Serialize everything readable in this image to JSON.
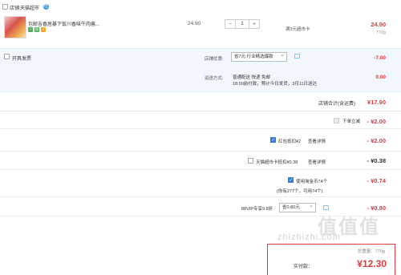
{
  "shop": {
    "label": "店铺:",
    "name": "天猫超市",
    "ww_icon": "旺"
  },
  "item": {
    "title": "包邮吉香居暴下饭川香味牛肉酱...",
    "tags": [
      {
        "text": "7",
        "color": "#4caf50"
      },
      {
        "text": "保",
        "color": "#4caf50"
      },
      {
        "text": "✦",
        "color": "#f5a623"
      }
    ],
    "unit_price": "24.90",
    "quantity": "1",
    "minus": "−",
    "plus": "+",
    "limit_text": "满3元超市卡",
    "total": "24.90",
    "weight": "770g"
  },
  "invoice": {
    "label": "开具发票"
  },
  "discount": {
    "label": "店铺优惠:",
    "selected": "省7元:行业精选爆款",
    "amount": "-7.00"
  },
  "shipping": {
    "label": "运送方式:",
    "methods": "普通配送 快递 免邮",
    "eta": "18:00前付款，预计今日发货，3月11日送达",
    "fee": "0.00"
  },
  "shop_total": {
    "label": "店铺合计(含运费)",
    "value": "¥17.90"
  },
  "order_rows": [
    {
      "label": "下单立减",
      "value": "- ¥2.00",
      "checked": true
    },
    {
      "label": "红包抵扣¥2",
      "link": "查看详情",
      "value": "- ¥2.00",
      "checked": true
    },
    {
      "label": "天猫超市卡抵扣¥0.38",
      "link": "查看详情",
      "value": "- ¥0.38",
      "checked": false
    },
    {
      "label": "使用淘金币74个",
      "sub": "(你有277个，可用74个)",
      "value": "- ¥0.74",
      "checked": true
    },
    {
      "label": "88VIP专享9.5折",
      "select": "省0.80元",
      "value": "- ¥0.80"
    }
  ],
  "summary": {
    "weight": "总重量：770g",
    "label": "实付款：",
    "value": "¥12.30"
  },
  "watermark": {
    "text": "zhizhizhi.com",
    "big": "值值值"
  },
  "colors": {
    "accent_red": "#e4393c",
    "link_blue": "#1a73e8",
    "checkbox_blue": "#3a7bd5",
    "section_bg": "#f2f7fd"
  }
}
